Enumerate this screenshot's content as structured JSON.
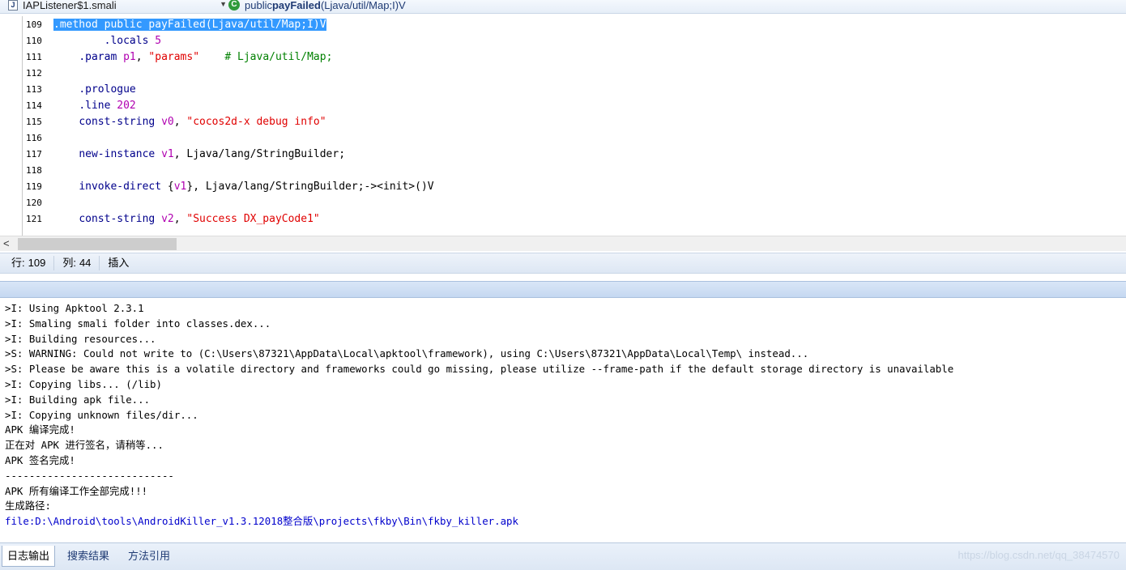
{
  "navbar": {
    "file_combo": {
      "icon_letter": "J",
      "label": "IAPListener$1.smali"
    },
    "method_combo": {
      "icon_letter": "C",
      "prefix": "public ",
      "name": "payFailed",
      "suffix": "(Ljava/util/Map;I)V"
    }
  },
  "editor": {
    "lines": [
      {
        "no": "109",
        "tokens": [
          {
            "cls": "selected",
            "t": ".method public payFailed(Ljava/util/Map;I)V"
          }
        ]
      },
      {
        "no": "110",
        "tokens": [
          {
            "cls": "plain",
            "t": "        "
          },
          {
            "cls": "kw",
            "t": ".locals "
          },
          {
            "cls": "num",
            "t": "5"
          }
        ]
      },
      {
        "no": "111",
        "tokens": [
          {
            "cls": "plain",
            "t": "    "
          },
          {
            "cls": "kw",
            "t": ".param "
          },
          {
            "cls": "reg",
            "t": "p1"
          },
          {
            "cls": "plain",
            "t": ", "
          },
          {
            "cls": "str",
            "t": "\"params\""
          },
          {
            "cls": "plain",
            "t": "    "
          },
          {
            "cls": "cmt",
            "t": "# Ljava/util/Map;"
          }
        ]
      },
      {
        "no": "112",
        "tokens": []
      },
      {
        "no": "113",
        "tokens": [
          {
            "cls": "plain",
            "t": "    "
          },
          {
            "cls": "kw",
            "t": ".prologue"
          }
        ]
      },
      {
        "no": "114",
        "tokens": [
          {
            "cls": "plain",
            "t": "    "
          },
          {
            "cls": "kw",
            "t": ".line "
          },
          {
            "cls": "num",
            "t": "202"
          }
        ]
      },
      {
        "no": "115",
        "tokens": [
          {
            "cls": "plain",
            "t": "    "
          },
          {
            "cls": "kw",
            "t": "const-string "
          },
          {
            "cls": "reg",
            "t": "v0"
          },
          {
            "cls": "plain",
            "t": ", "
          },
          {
            "cls": "str",
            "t": "\"cocos2d-x debug info\""
          }
        ]
      },
      {
        "no": "116",
        "tokens": []
      },
      {
        "no": "117",
        "tokens": [
          {
            "cls": "plain",
            "t": "    "
          },
          {
            "cls": "kw",
            "t": "new-instance "
          },
          {
            "cls": "reg",
            "t": "v1"
          },
          {
            "cls": "plain",
            "t": ", Ljava/lang/StringBuilder;"
          }
        ]
      },
      {
        "no": "118",
        "tokens": []
      },
      {
        "no": "119",
        "tokens": [
          {
            "cls": "plain",
            "t": "    "
          },
          {
            "cls": "kw",
            "t": "invoke-direct "
          },
          {
            "cls": "plain",
            "t": "{"
          },
          {
            "cls": "reg",
            "t": "v1"
          },
          {
            "cls": "plain",
            "t": "}, Ljava/lang/StringBuilder;-><init>()V"
          }
        ]
      },
      {
        "no": "120",
        "tokens": []
      },
      {
        "no": "121",
        "tokens": [
          {
            "cls": "plain",
            "t": "    "
          },
          {
            "cls": "kw",
            "t": "const-string "
          },
          {
            "cls": "reg",
            "t": "v2"
          },
          {
            "cls": "plain",
            "t": ", "
          },
          {
            "cls": "str",
            "t": "\"Success DX_payCode1\""
          }
        ]
      }
    ]
  },
  "scrollbar": {
    "left_arrow": "<"
  },
  "statusbar": {
    "row_label": "行:",
    "row_value": "109",
    "col_label": "列:",
    "col_value": "44",
    "mode": "插入"
  },
  "log": {
    "lines": [
      ">I: Using Apktool 2.3.1",
      ">I: Smaling smali folder into classes.dex...",
      ">I: Building resources...",
      ">S: WARNING: Could not write to (C:\\Users\\87321\\AppData\\Local\\apktool\\framework), using C:\\Users\\87321\\AppData\\Local\\Temp\\ instead...",
      ">S: Please be aware this is a volatile directory and frameworks could go missing, please utilize --frame-path if the default storage directory is unavailable",
      ">I: Copying libs... (/lib)",
      ">I: Building apk file...",
      ">I: Copying unknown files/dir...",
      "APK 编译完成!",
      "正在对 APK 进行签名，请稍等...",
      "APK 签名完成!",
      "----------------------------",
      "APK 所有编译工作全部完成!!!",
      "生成路径:"
    ],
    "link": "file:D:\\Android\\tools\\AndroidKiller_v1.3.12018整合版\\projects\\fkby\\Bin\\fkby_killer.apk"
  },
  "tabs": {
    "items": [
      "日志输出",
      "搜索结果",
      "方法引用"
    ],
    "active": 0
  },
  "watermark": "https://blog.csdn.net/qq_38474570"
}
